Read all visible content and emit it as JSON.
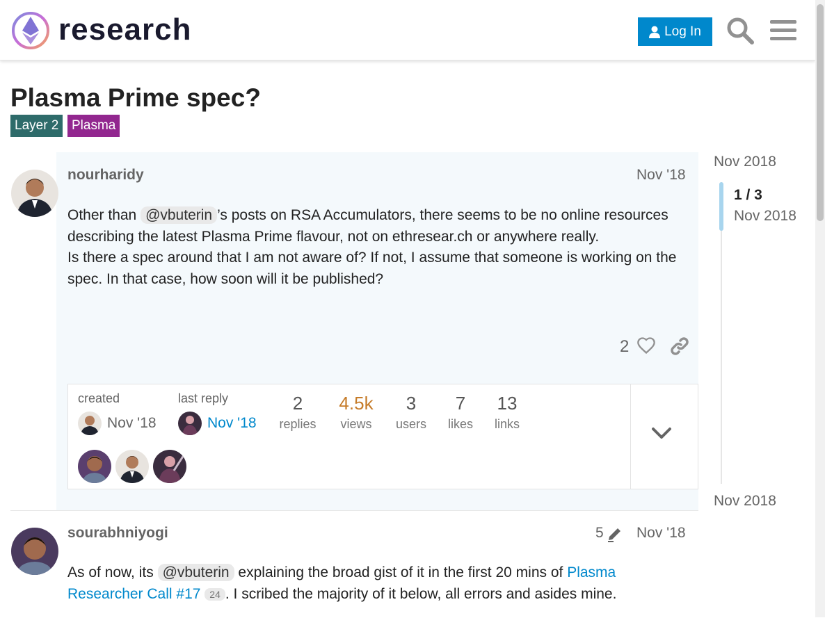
{
  "header": {
    "logo_text": "research",
    "login_label": "Log In",
    "search_icon": "search-icon",
    "menu_icon": "hamburger-menu-icon"
  },
  "topic": {
    "title": "Plasma Prime spec?",
    "tags": [
      {
        "label": "Layer 2",
        "color": "#2e6b6a"
      },
      {
        "label": "Plasma",
        "color": "#92278f"
      }
    ]
  },
  "posts": [
    {
      "username": "nourharidy",
      "date": "Nov '18",
      "text_before_mention": "Other than ",
      "mention": "@vbuterin",
      "text_after_mention": "’s posts on RSA Accumulators, there seems to be no online resources describing the latest Plasma Prime flavour, not on ethresear.ch or anywhere really.",
      "text_line2": "Is there a spec around that I am not aware of? If not, I assume that someone is working on the spec. In that case, how soon will it be published?",
      "likes": "2"
    },
    {
      "username": "sourabhniyogi",
      "edits": "5",
      "date": "Nov '18",
      "text_before_mention": "As of now, its ",
      "mention": "@vbuterin",
      "text_mid": " explaining the broad gist of it in the first 20 mins of ",
      "link_text": "Plasma Researcher Call #17",
      "link_count": "24",
      "text_after_link": ". I scribed the majority of it below, all errors and asides mine."
    }
  ],
  "topic_map": {
    "created_label": "created",
    "created_date": "Nov '18",
    "last_reply_label": "last reply",
    "last_reply_date": "Nov '18",
    "stats": [
      {
        "num": "2",
        "label": "replies",
        "color": "#555555"
      },
      {
        "num": "4.5k",
        "label": "views",
        "color": "#c67c2a"
      },
      {
        "num": "3",
        "label": "users",
        "color": "#555555"
      },
      {
        "num": "7",
        "label": "likes",
        "color": "#555555"
      },
      {
        "num": "13",
        "label": "links",
        "color": "#555555"
      }
    ]
  },
  "timeline": {
    "top_date": "Nov 2018",
    "position": "1 / 3",
    "current_date": "Nov 2018",
    "bottom_date": "Nov 2018"
  }
}
